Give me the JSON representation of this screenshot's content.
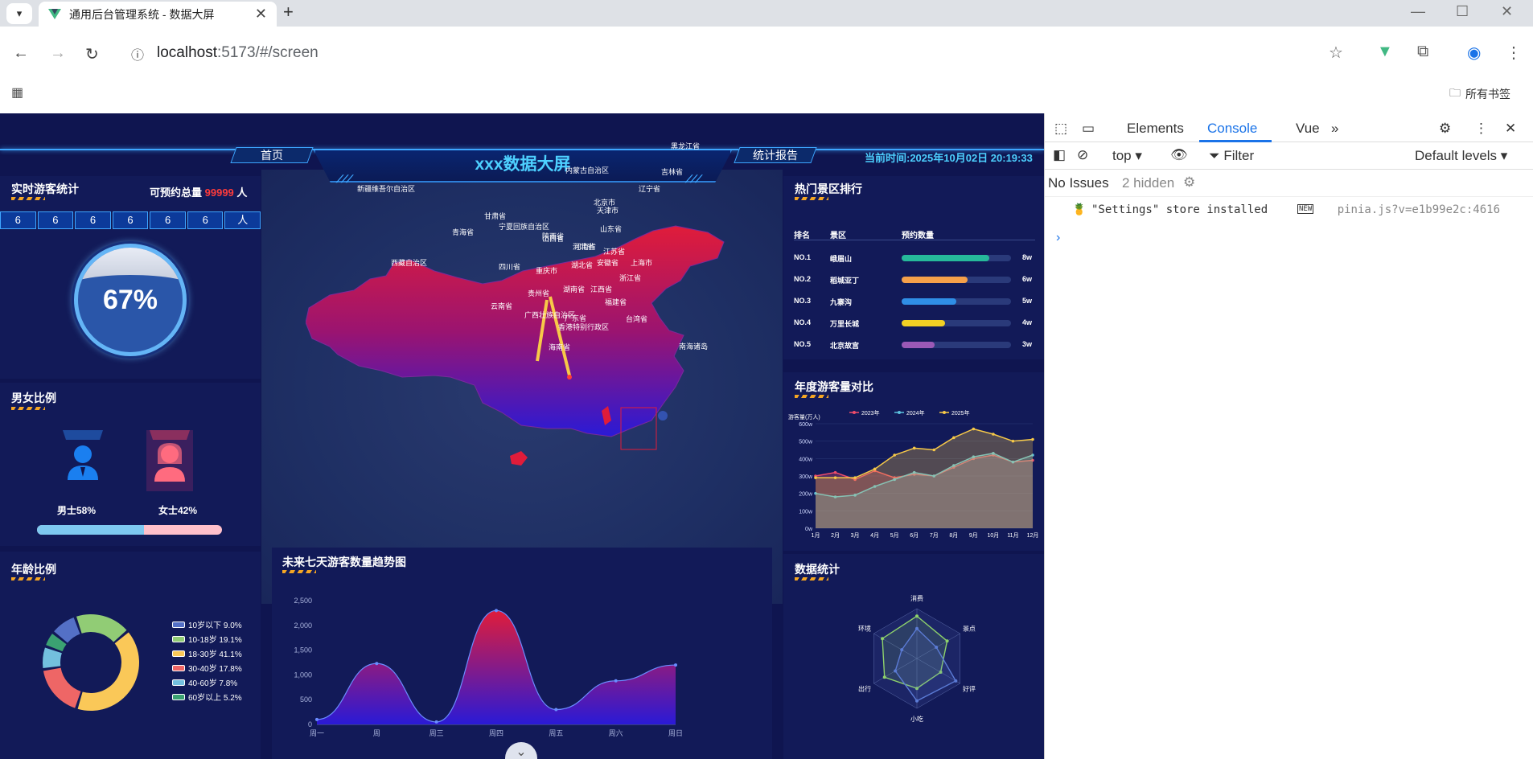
{
  "browser": {
    "tab_title": "通用后台管理系统 - 数据大屏",
    "url_host": "localhost",
    "url_path": ":5173/#/screen",
    "bookmarks_label": "所有书签"
  },
  "header": {
    "home_btn": "首页",
    "report_btn": "统计报告",
    "title": "xxx数据大屏",
    "time": "当前时间:2025年10月02日 20:19:33"
  },
  "visitors": {
    "title": "实时游客统计",
    "total_prefix": "可预约总量",
    "total_value": "99999",
    "total_suffix": "人",
    "digits": [
      "6",
      "6",
      "6",
      "6",
      "6",
      "6",
      "人"
    ],
    "percent": "67%"
  },
  "gender": {
    "title": "男女比例",
    "male_label": "男士58%",
    "female_label": "女士42%",
    "male_ratio": 0.58,
    "colors": {
      "male": "#7ec8f0",
      "female": "#ffc0cb"
    }
  },
  "age": {
    "title": "年龄比例",
    "legend": [
      {
        "label": "10岁以下 9.0%",
        "color": "#5470c6",
        "value": 9.0
      },
      {
        "label": "10-18岁 19.1%",
        "color": "#91cc75",
        "value": 19.1
      },
      {
        "label": "18-30岁 41.1%",
        "color": "#fac858",
        "value": 41.1
      },
      {
        "label": "30-40岁 17.8%",
        "color": "#ee6666",
        "value": 17.8
      },
      {
        "label": "40-60岁 7.8%",
        "color": "#73c0de",
        "value": 7.8
      },
      {
        "label": "60岁以上 5.2%",
        "color": "#3ba272",
        "value": 5.2
      }
    ]
  },
  "map": {
    "provinces": [
      "黑龙江省",
      "吉林省",
      "辽宁省",
      "内蒙古自治区",
      "新疆维吾尔自治区",
      "甘肃省",
      "宁夏回族自治区",
      "山西省",
      "河北省",
      "北京市",
      "天津市",
      "山东省",
      "青海省",
      "陕西省",
      "河南省",
      "江苏省",
      "上海市",
      "安徽省",
      "湖北省",
      "西藏自治区",
      "四川省",
      "重庆市",
      "浙江省",
      "湖南省",
      "江西省",
      "贵州省",
      "福建省",
      "云南省",
      "广西壮族自治区",
      "广东省",
      "台湾省",
      "香港特别行政区",
      "海南省",
      "南海诸岛"
    ]
  },
  "ranking": {
    "title": "热门景区排行",
    "headers": [
      "排名",
      "景区",
      "预约数量"
    ],
    "rows": [
      {
        "no": "NO.1",
        "name": "峨眉山",
        "val": "8w",
        "ratio": 0.8,
        "color": "#26b99a"
      },
      {
        "no": "NO.2",
        "name": "稻城亚丁",
        "val": "6w",
        "ratio": 0.6,
        "color": "#f5a04a"
      },
      {
        "no": "NO.3",
        "name": "九寨沟",
        "val": "5w",
        "ratio": 0.5,
        "color": "#2f8ee6"
      },
      {
        "no": "NO.4",
        "name": "万里长城",
        "val": "4w",
        "ratio": 0.4,
        "color": "#f2d024"
      },
      {
        "no": "NO.5",
        "name": "北京故宫",
        "val": "3w",
        "ratio": 0.3,
        "color": "#9b59b6"
      }
    ]
  },
  "yearly_title": "年度游客量对比",
  "trend_title": "未来七天游客数量趋势图",
  "radar_title": "数据统计",
  "chart_data": [
    {
      "type": "line",
      "title": "年度游客量对比",
      "ylabel": "游客量(万人)",
      "x": [
        "1月",
        "2月",
        "3月",
        "4月",
        "5月",
        "6月",
        "7月",
        "8月",
        "9月",
        "10月",
        "11月",
        "12月"
      ],
      "yticks": [
        "0w",
        "100w",
        "200w",
        "300w",
        "400w",
        "500w",
        "600w"
      ],
      "ylim": [
        0,
        600
      ],
      "legend_position": "top",
      "series": [
        {
          "name": "2023年",
          "color": "#ee4c6a",
          "values": [
            300,
            320,
            280,
            330,
            290,
            310,
            300,
            350,
            400,
            420,
            380,
            390
          ]
        },
        {
          "name": "2024年",
          "color": "#5bc0de",
          "values": [
            200,
            180,
            190,
            240,
            280,
            320,
            300,
            360,
            410,
            430,
            380,
            420
          ]
        },
        {
          "name": "2025年",
          "color": "#f7c948",
          "values": [
            290,
            290,
            290,
            340,
            420,
            460,
            450,
            520,
            570,
            540,
            500,
            510
          ]
        }
      ]
    },
    {
      "type": "area",
      "title": "未来七天游客数量趋势图",
      "x": [
        "周一",
        "周",
        "周三",
        "周四",
        "周五",
        "周六",
        "周日"
      ],
      "yticks": [
        "0",
        "500",
        "1,000",
        "1,500",
        "2,000",
        "2,500"
      ],
      "ylim": [
        0,
        2500
      ],
      "series": [
        {
          "name": "",
          "values": [
            100,
            1230,
            50,
            2300,
            300,
            880,
            1200
          ]
        }
      ]
    },
    {
      "type": "radar",
      "title": "数据统计",
      "indicators": [
        "消费",
        "景点",
        "好评",
        "小吃",
        "出行",
        "环境"
      ],
      "series": [
        {
          "name": "",
          "color": "#8ed26b",
          "values": [
            0.85,
            0.7,
            0.55,
            0.6,
            0.75,
            0.8
          ]
        },
        {
          "name": "",
          "color": "#5b7bd5",
          "values": [
            0.6,
            0.45,
            0.9,
            0.85,
            0.5,
            0.35
          ]
        }
      ]
    }
  ],
  "devtools": {
    "tabs": [
      "Elements",
      "Console",
      "Vue"
    ],
    "context": "top",
    "filter": "Filter",
    "levels": "Default levels",
    "issues": "No Issues",
    "hidden": "2 hidden",
    "message": "\"Settings\" store installed",
    "new_badge": "NEW",
    "source": "pinia.js?v=e1b99e2c:4616"
  }
}
